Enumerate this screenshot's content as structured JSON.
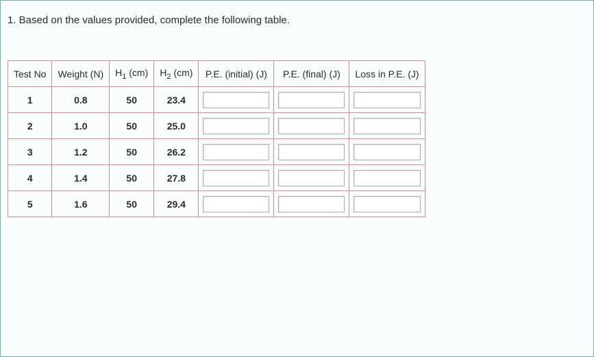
{
  "question": "1. Based on the values provided, complete the following table.",
  "headers": {
    "testno": "Test No",
    "weight": "Weight (N)",
    "h1_prefix": "H",
    "h1_sub": "1",
    "h1_suffix": " (cm)",
    "h2_prefix": "H",
    "h2_sub": "2",
    "h2_suffix": " (cm)",
    "pe_init": "P.E. (initial) (J)",
    "pe_final": "P.E. (final) (J)",
    "loss": "Loss in P.E. (J)"
  },
  "rows": [
    {
      "testno": "1",
      "weight": "0.8",
      "h1": "50",
      "h2": "23.4",
      "pe_init": "",
      "pe_final": "",
      "loss": ""
    },
    {
      "testno": "2",
      "weight": "1.0",
      "h1": "50",
      "h2": "25.0",
      "pe_init": "",
      "pe_final": "",
      "loss": ""
    },
    {
      "testno": "3",
      "weight": "1.2",
      "h1": "50",
      "h2": "26.2",
      "pe_init": "",
      "pe_final": "",
      "loss": ""
    },
    {
      "testno": "4",
      "weight": "1.4",
      "h1": "50",
      "h2": "27.8",
      "pe_init": "",
      "pe_final": "",
      "loss": ""
    },
    {
      "testno": "5",
      "weight": "1.6",
      "h1": "50",
      "h2": "29.4",
      "pe_init": "",
      "pe_final": "",
      "loss": ""
    }
  ]
}
